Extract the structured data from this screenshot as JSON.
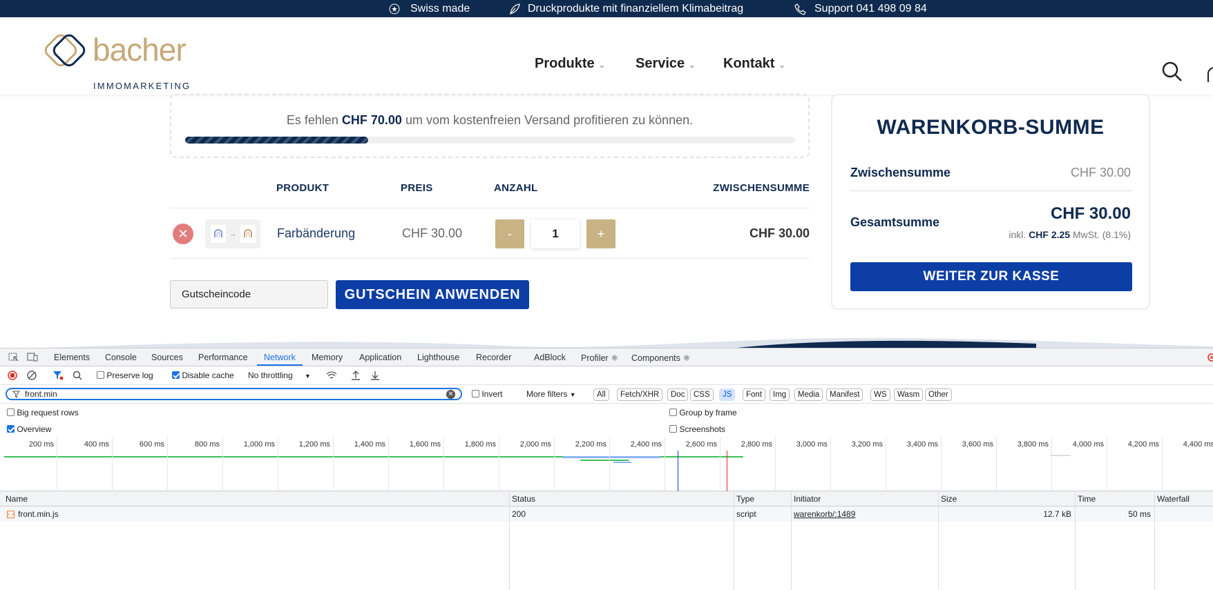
{
  "topbar": {
    "swiss": "Swiss made",
    "print": "Druckprodukte mit finanziellem Klimabeitrag",
    "support": "Support 041 498 09 84"
  },
  "logo": {
    "word": "bacher",
    "sub": "IMMOMARKETING"
  },
  "nav": {
    "products": "Produkte",
    "service": "Service",
    "contact": "Kontakt"
  },
  "shipping": {
    "prefix": "Es fehlen",
    "amount": "CHF 70.00",
    "suffix": "um vom kostenfreien Versand profitieren zu können.",
    "progress_percent": 30
  },
  "cart": {
    "headers": {
      "product": "PRODUKT",
      "price": "PREIS",
      "qty": "ANZAHL",
      "subtotal": "ZWISCHENSUMME"
    },
    "item": {
      "remove": "✕",
      "name": "Farbänderung",
      "price": "CHF 30.00",
      "minus": "-",
      "qty": "1",
      "plus": "+",
      "subtotal": "CHF 30.00"
    },
    "coupon_placeholder": "Gutscheincode",
    "coupon_button": "GUTSCHEIN  ANWENDEN"
  },
  "totals": {
    "title": "WARENKORB-SUMME",
    "subtotal_label": "Zwischensumme",
    "subtotal_value": "CHF 30.00",
    "total_label": "Gesamtsumme",
    "total_value": "CHF 30.00",
    "vat_prefix": "inkl.",
    "vat_amount": "CHF 2.25",
    "vat_suffix": "MwSt. (8.1%)",
    "checkout": "WEITER ZUR KASSE"
  },
  "devtools": {
    "tabs": [
      "Elements",
      "Console",
      "Sources",
      "Performance",
      "Network",
      "Memory",
      "Application",
      "Lighthouse",
      "Recorder",
      "AdBlock",
      "Profiler ⚛",
      "Components ⚛"
    ],
    "active_tab": "Network",
    "preserve_log": "Preserve log",
    "disable_cache": "Disable cache",
    "throttling": "No throttling",
    "filter_value": "front.min",
    "invert": "Invert",
    "more_filters": "More filters",
    "type_filters": [
      "All",
      "Fetch/XHR",
      "Doc",
      "CSS",
      "JS",
      "Font",
      "Img",
      "Media",
      "Manifest",
      "WS",
      "Wasm",
      "Other"
    ],
    "active_type": "JS",
    "big_rows": "Big request rows",
    "group_frame": "Group by frame",
    "overview": "Overview",
    "screenshots": "Screenshots",
    "ticks": [
      "200 ms",
      "400 ms",
      "600 ms",
      "800 ms",
      "1,000 ms",
      "1,200 ms",
      "1,400 ms",
      "1,600 ms",
      "1,800 ms",
      "2,000 ms",
      "2,200 ms",
      "2,400 ms",
      "2,600 ms",
      "2,800 ms",
      "3,000 ms",
      "3,200 ms",
      "3,400 ms",
      "3,600 ms",
      "3,800 ms",
      "4,000 ms",
      "4,200 ms",
      "4,400 ms"
    ],
    "columns": {
      "name": "Name",
      "status": "Status",
      "type": "Type",
      "initiator": "Initiator",
      "size": "Size",
      "time": "Time",
      "waterfall": "Waterfall"
    },
    "row": {
      "name": "front.min.js",
      "status": "200",
      "type": "script",
      "initiator": "warenkorb/:1489",
      "size": "12.7 kB",
      "time": "50 ms"
    },
    "colors": {
      "accent": "#1a73e8",
      "dcl": "#1a3fd0",
      "load": "#e8232d",
      "bar": "#3bbf5a"
    }
  }
}
